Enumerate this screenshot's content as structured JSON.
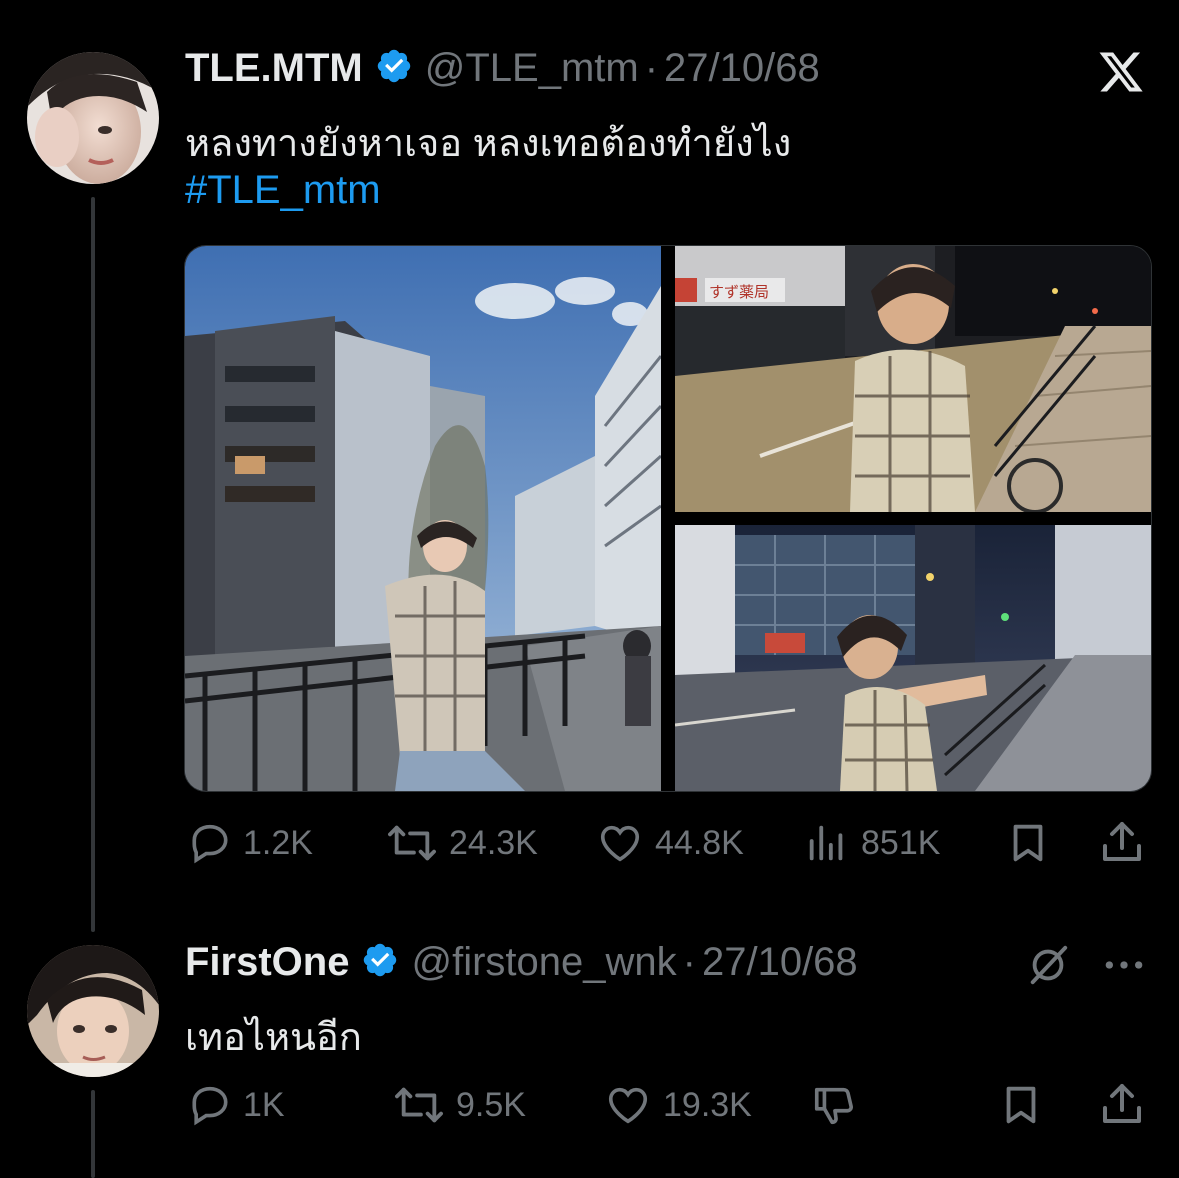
{
  "main_tweet": {
    "display_name": "TLE.MTM",
    "handle": "@TLE_mtm",
    "separator": "·",
    "date": "27/10/68",
    "text": "หลงทางยังหาเจอ หลงเทอต้องทำยังไง",
    "hashtag": "#TLE_mtm",
    "actions": {
      "replies": "1.2K",
      "reposts": "24.3K",
      "likes": "44.8K",
      "views": "851K"
    },
    "photo_sign_text": "すず薬局"
  },
  "reply_tweet": {
    "display_name": "FirstOne",
    "handle": "@firstone_wnk",
    "separator": "·",
    "date": "27/10/68",
    "text": "เทอไหนอีก",
    "actions": {
      "replies": "1K",
      "reposts": "9.5K",
      "likes": "19.3K"
    }
  },
  "colors": {
    "background": "#000000",
    "accent": "#1d9bf0",
    "muted": "#71767b",
    "verified": "#1d9bf0"
  },
  "icons": [
    "x-logo-icon",
    "verified-icon",
    "reply-icon",
    "repost-icon",
    "like-icon",
    "views-icon",
    "bookmark-icon",
    "share-icon",
    "grok-icon",
    "more-icon",
    "dislike-icon"
  ]
}
